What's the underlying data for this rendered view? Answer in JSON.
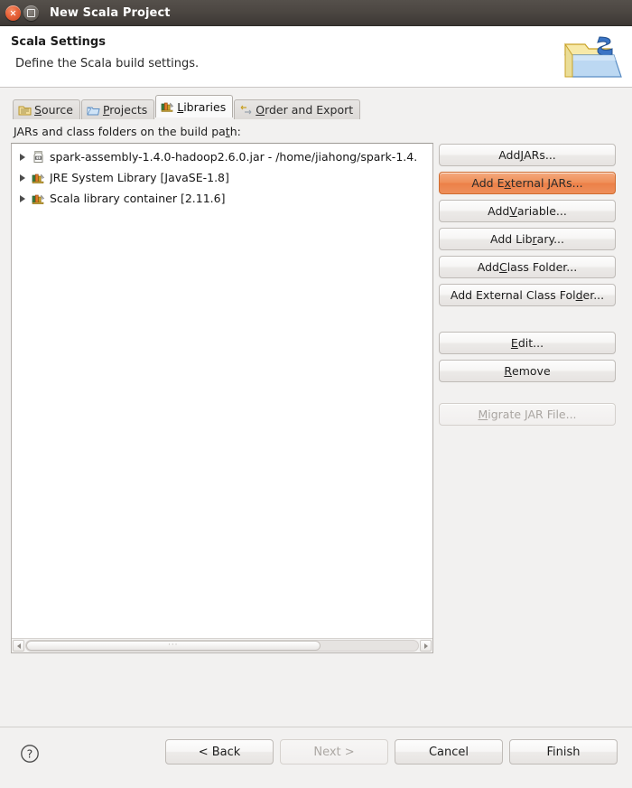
{
  "window": {
    "title": "New Scala Project",
    "close_icon": "close-icon",
    "maximize_icon": "maximize-icon"
  },
  "header": {
    "title": "Scala Settings",
    "subtitle": "Define the Scala build settings.",
    "icon": "scala-project-folder-icon"
  },
  "tabs": [
    {
      "label_pre": "",
      "label_mn": "S",
      "label_post": "ource",
      "icon": "source-folder-icon",
      "active": false,
      "name": "tab-source"
    },
    {
      "label_pre": "",
      "label_mn": "P",
      "label_post": "rojects",
      "icon": "projects-folder-icon",
      "active": false,
      "name": "tab-projects"
    },
    {
      "label_pre": "",
      "label_mn": "L",
      "label_post": "ibraries",
      "icon": "libraries-books-icon",
      "active": true,
      "name": "tab-libraries"
    },
    {
      "label_pre": "",
      "label_mn": "O",
      "label_post": "rder and Export",
      "icon": "order-export-arrows-icon",
      "active": false,
      "name": "tab-order-and-export"
    }
  ],
  "panel": {
    "label_pre": "JARs and class folders on the build pa",
    "label_mn": "t",
    "label_post": "h:"
  },
  "tree": {
    "items": [
      {
        "text": "spark-assembly-1.4.0-hadoop2.6.0.jar - /home/jiahong/spark-1.4.",
        "icon": "jar-icon"
      },
      {
        "text": "JRE System Library [JavaSE-1.8]",
        "icon": "library-icon"
      },
      {
        "text": "Scala library container [2.11.6]",
        "icon": "library-icon"
      }
    ]
  },
  "scrollbar": {
    "left_arrow_icon": "scroll-left-arrow-icon",
    "right_arrow_icon": "scroll-right-arrow-icon",
    "grip": "···",
    "thumb_percent": "75"
  },
  "side_buttons": [
    {
      "pre": "Add ",
      "mn": "J",
      "post": "ARs...",
      "state": "normal",
      "name": "add-jars-button"
    },
    {
      "pre": "Add E",
      "mn": "x",
      "post": "ternal JARs...",
      "state": "hover",
      "name": "add-external-jars-button"
    },
    {
      "pre": "Add ",
      "mn": "V",
      "post": "ariable...",
      "state": "normal",
      "name": "add-variable-button"
    },
    {
      "pre": "Add Lib",
      "mn": "r",
      "post": "ary...",
      "state": "normal",
      "name": "add-library-button"
    },
    {
      "pre": "Add ",
      "mn": "C",
      "post": "lass Folder...",
      "state": "normal",
      "name": "add-class-folder-button"
    },
    {
      "pre": "Add External Class Fol",
      "mn": "d",
      "post": "er...",
      "state": "normal",
      "name": "add-external-class-folder-button"
    }
  ],
  "side_buttons_2": [
    {
      "pre": "",
      "mn": "E",
      "post": "dit...",
      "state": "normal",
      "name": "edit-button"
    },
    {
      "pre": "",
      "mn": "R",
      "post": "emove",
      "state": "normal",
      "name": "remove-button"
    }
  ],
  "side_buttons_3": [
    {
      "pre": "",
      "mn": "M",
      "post": "igrate JAR File...",
      "state": "disabled",
      "name": "migrate-jar-file-button"
    }
  ],
  "footer": {
    "help_icon": "help-question-icon",
    "buttons": [
      {
        "label": "< Back",
        "state": "normal",
        "name": "back-button"
      },
      {
        "label": "Next >",
        "state": "disabled",
        "name": "next-button"
      },
      {
        "label": "Cancel",
        "state": "normal",
        "name": "cancel-button"
      },
      {
        "label": "Finish",
        "state": "normal",
        "name": "finish-button"
      }
    ]
  },
  "colors": {
    "accent_orange": "#ec8048",
    "titlebar": "#4b4641",
    "panel_bg": "#f2f1f0"
  }
}
